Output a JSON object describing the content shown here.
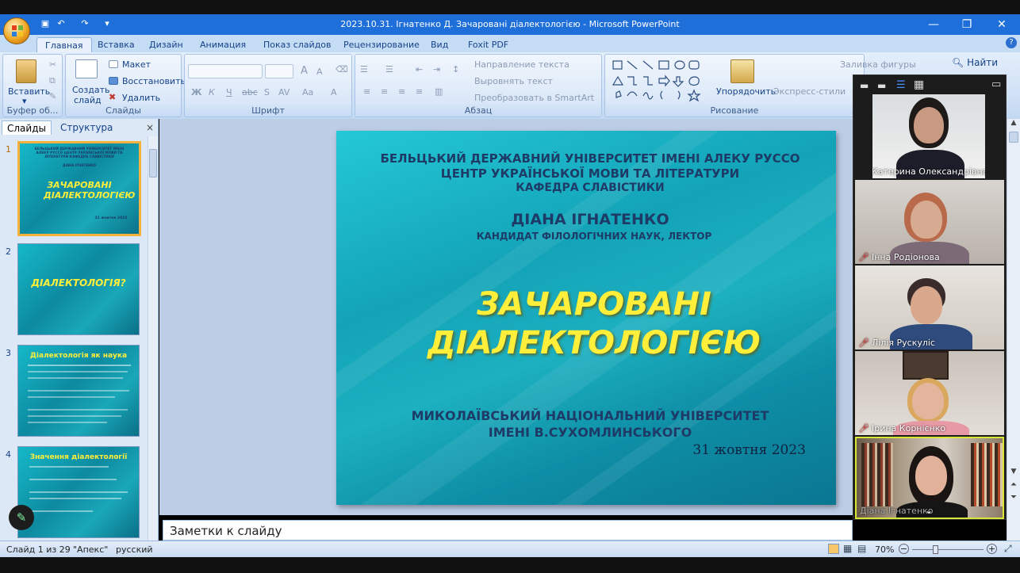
{
  "window": {
    "title": "2023.10.31. Ігнатенко Д. Зачаровані діалектологією - Microsoft PowerPoint"
  },
  "ribbon_tabs": [
    "Главная",
    "Вставка",
    "Дизайн",
    "Анимация",
    "Показ слайдов",
    "Рецензирование",
    "Вид",
    "Foxit PDF"
  ],
  "ribbon": {
    "clipboard": {
      "paste": "Вставить",
      "label": "Буфер об..."
    },
    "slides": {
      "new_slide": "Создать",
      "new_slide2": "слайд",
      "layout": "Макет",
      "reset": "Восстановить",
      "delete": "Удалить",
      "label": "Слайды"
    },
    "font": {
      "label": "Шрифт",
      "bold": "Ж",
      "italic": "К",
      "underline": "Ч",
      "strike": "abc",
      "shadow": "S",
      "spacing": "AV",
      "case": "Aa",
      "color": "A"
    },
    "paragraph": {
      "label": "Абзац",
      "direction": "Направление текста",
      "align": "Выровнять текст",
      "smartart": "Преобразовать в SmartArt"
    },
    "drawing": {
      "arrange": "Упорядочить",
      "quick_styles": "Экспресс-стили",
      "fill": "Заливка фигуры",
      "label": "Рисование"
    },
    "editing": {
      "find": "Найти"
    }
  },
  "left_pane": {
    "tabs": [
      "Слайды",
      "Структура"
    ],
    "slides": [
      {
        "num": "1",
        "header": "БЕЛЬЦЬКИЙ ДЕРЖАВНИЙ УНІВЕРСИТЕТ ІМЕНІ АЛЕКУ РУССО ЦЕНТР УКРАЇНСЬКОЇ МОВИ ТА ЛІТЕРАТУРИ КАФЕДРА СЛАВІСТИКИ",
        "author": "ДІАНА ІГНАТЕНКО",
        "title": "ЗАЧАРОВАНІ ДІАЛЕКТОЛОГІЄЮ",
        "date": "31 жовтня 2023"
      },
      {
        "num": "2",
        "title": "ДІАЛЕКТОЛОГІЯ?"
      },
      {
        "num": "3",
        "title": "Діалектологія як наука"
      },
      {
        "num": "4",
        "title": "Значення діалектології"
      }
    ]
  },
  "slide": {
    "line1": "БЕЛЬЦЬКИЙ ДЕРЖАВНИЙ УНІВЕРСИТЕТ ІМЕНІ АЛЕКУ РУССО",
    "line2": "ЦЕНТР УКРАЇНСЬКОЇ МОВИ ТА ЛІТЕРАТУРИ",
    "line3": "КАФЕДРА СЛАВІСТИКИ",
    "author": "ДІАНА ІГНАТЕНКО",
    "degree": "КАНДИДАТ ФІЛОЛОГІЧНИХ НАУК, ЛЕКТОР",
    "title1": "ЗАЧАРОВАНІ",
    "title2": "ДІАЛЕКТОЛОГІЄЮ",
    "uni1": "МИКОЛАЇВСЬКИЙ НАЦІОНАЛЬНИЙ УНІВЕРСИТЕТ",
    "uni2": "ІМЕНІ В.СУХОМЛИНСЬКОГО",
    "date": "31 жовтня 2023"
  },
  "notes_placeholder": "Заметки к слайду",
  "status": {
    "slide": "Слайд 1 из 29",
    "theme": "\"Апекс\"",
    "lang": "русский",
    "zoom": "70%"
  },
  "participants": [
    {
      "name": "Катерина Олександрівна",
      "muted": true
    },
    {
      "name": "Інна Родіонова",
      "muted": true
    },
    {
      "name": "Лілія Рускуліс",
      "muted": true
    },
    {
      "name": "Ірина Корнієнко",
      "muted": true
    },
    {
      "name": "Діана Ігнатенко",
      "muted": false
    }
  ],
  "colors": {
    "title_blue": "#1e6fd9",
    "slide_text": "#1d3b66",
    "slide_title": "#ffef3a",
    "accent_orange": "#f6b23c"
  }
}
